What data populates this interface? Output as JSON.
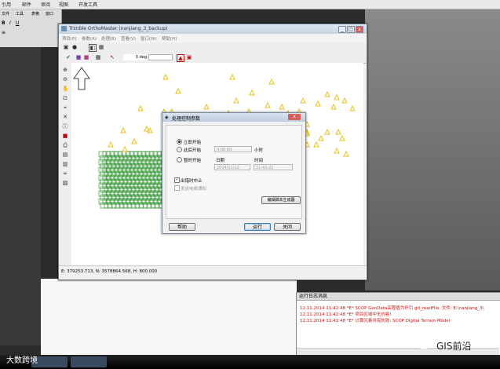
{
  "word": {
    "menu": [
      "引用",
      "邮件",
      "审阅",
      "视图",
      "开发工具"
    ],
    "toolbar_labels": [
      "文件",
      "工具",
      "表格",
      "窗口",
      "帮助"
    ]
  },
  "orthomaster": {
    "title": "Trimble OrthoMaster (nanjiang_3_backup)",
    "menu": [
      "项目(P)",
      "参数(A)",
      "处理(R)",
      "查看(V)",
      "窗口(W)",
      "帮助(H)"
    ],
    "angle_value": "0 deg",
    "status": "E: 379253.713, N: 3578864.568, H: 800.000"
  },
  "dialog": {
    "title": "处理控制参数",
    "group_label": "控制",
    "radio_now": "立即开始",
    "radio_after": "此后开始",
    "radio_at": "暂时开始",
    "after_value": "0:00:00",
    "after_unit": "小时",
    "date_label": "日期",
    "time_label": "时间",
    "date_value": "2014/11/12",
    "time_value": "11:43:21",
    "stop_on_error": "出错时中止",
    "send_email": "发送电邮通知",
    "edit_button": "编辑脚本生成器",
    "help_button": "帮助",
    "run_button": "运行",
    "close_button": "关闭"
  },
  "log": {
    "title": "运行日志消息",
    "lines": [
      "12.11.2014 11:42:48 *E* SCOP GeoData高程值为坏引 gd_readFile. 文件: E:\\nanjiang_3\\",
      "12.11.2014 11:42:48 *E* 项目区域中无内容!",
      "12.11.2014 11:42:48 *E* 计算元素共有失败: SCOP Digital Terrain Model"
    ]
  },
  "watermark": {
    "left": "大数跨境",
    "right": "GIS前沿"
  },
  "colors": {
    "triangle": "#e8c21a",
    "footprint": "#1d8a1d",
    "error_text": "#d01010"
  }
}
